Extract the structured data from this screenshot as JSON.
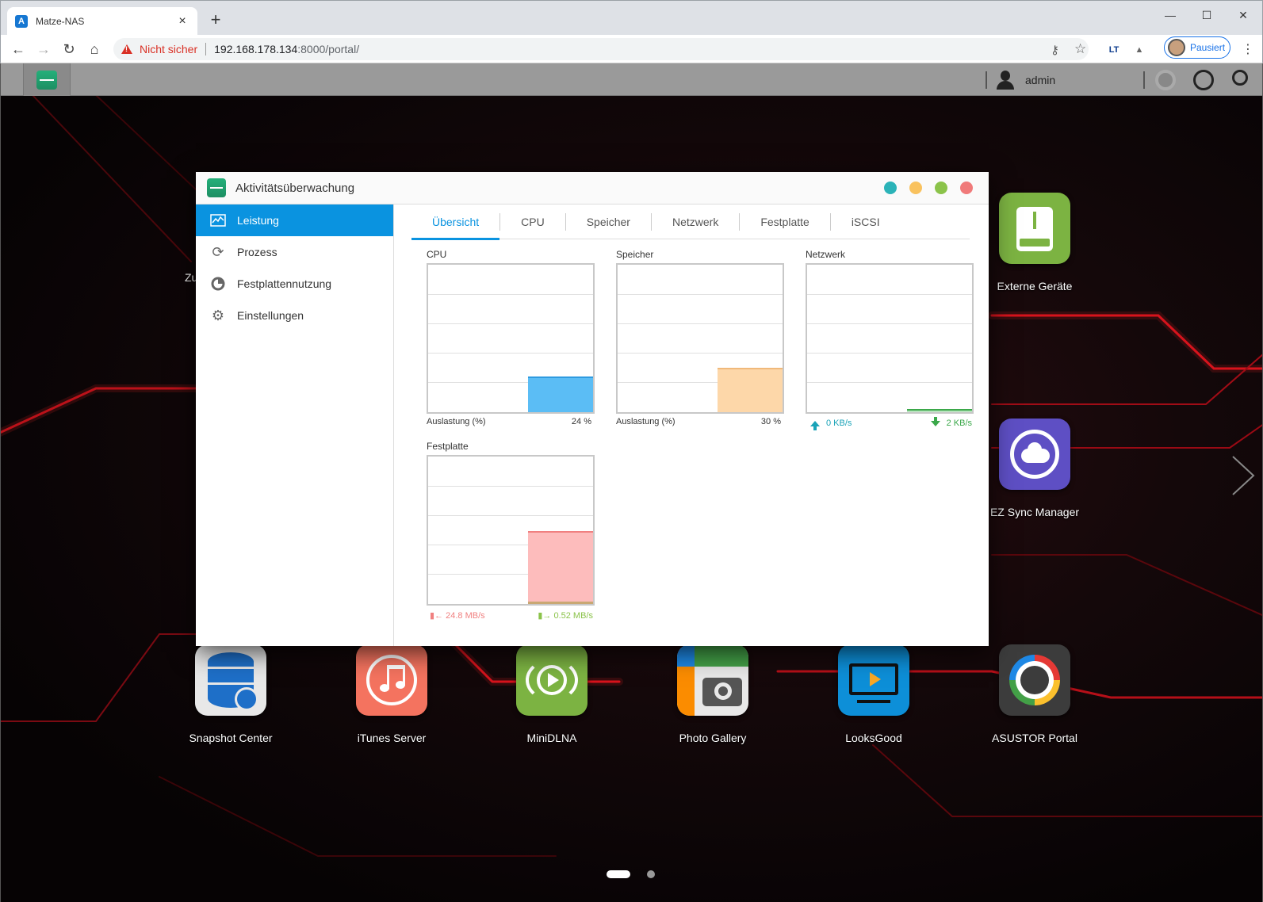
{
  "browser": {
    "tab_title": "Matze-NAS",
    "tab_favicon": "A",
    "new_tab": "+",
    "not_secure": "Nicht sicher",
    "url_host": "192.168.178.134",
    "url_rest": ":8000/portal/",
    "profile_label": "Pausiert",
    "extension_label": "LT"
  },
  "taskbar": {
    "user": "admin"
  },
  "window": {
    "title": "Aktivitätsüberwachung",
    "sidebar": [
      {
        "label": "Leistung",
        "icon": "chart-icon",
        "active": true
      },
      {
        "label": "Prozess",
        "icon": "refresh-icon",
        "active": false
      },
      {
        "label": "Festplattennutzung",
        "icon": "pie-icon",
        "active": false
      },
      {
        "label": "Einstellungen",
        "icon": "gear-icon",
        "active": false
      }
    ],
    "tabs": [
      "Übersicht",
      "CPU",
      "Speicher",
      "Netzwerk",
      "Festplatte",
      "iSCSI"
    ],
    "active_tab": "Übersicht"
  },
  "panels": {
    "cpu": {
      "title": "CPU",
      "label": "Auslastung (%)",
      "value": "24 %",
      "usage_fraction": 0.24,
      "color": "#5bbdf5"
    },
    "memory": {
      "title": "Speicher",
      "label": "Auslastung (%)",
      "value": "30 %",
      "usage_fraction": 0.3,
      "color": "#fdd7a9"
    },
    "network": {
      "title": "Netzwerk",
      "upload": "0 KB/s",
      "download": "2 KB/s",
      "upload_color": "#1aa3b8",
      "download_color": "#3ba84a"
    },
    "disk": {
      "title": "Festplatte",
      "read": "24.8 MB/s",
      "write": "0.52 MB/s",
      "read_color": "#f08080",
      "write_color": "#8bc34a"
    }
  },
  "desktop": {
    "partial_label": "Zu",
    "icons": [
      {
        "label": "Externe Geräte",
        "icon": "usb-drive-icon",
        "color": "#7cb342"
      },
      {
        "label": "EZ Sync Manager",
        "icon": "cloud-sync-icon",
        "color": "#5e4fc4"
      },
      {
        "label": "Snapshot Center",
        "icon": "database-camera-icon",
        "color": "#e8e8e8"
      },
      {
        "label": "iTunes Server",
        "icon": "music-note-icon",
        "color": "#f4735f"
      },
      {
        "label": "MiniDLNA",
        "icon": "stream-play-icon",
        "color": "#7cb342"
      },
      {
        "label": "Photo Gallery",
        "icon": "camera-icon",
        "color": "#e8e8e8"
      },
      {
        "label": "LooksGood",
        "icon": "tv-play-icon",
        "color": "#0d8fd8"
      },
      {
        "label": "ASUSTOR Portal",
        "icon": "portal-ring-icon",
        "color": "#3c3c3c"
      }
    ]
  }
}
